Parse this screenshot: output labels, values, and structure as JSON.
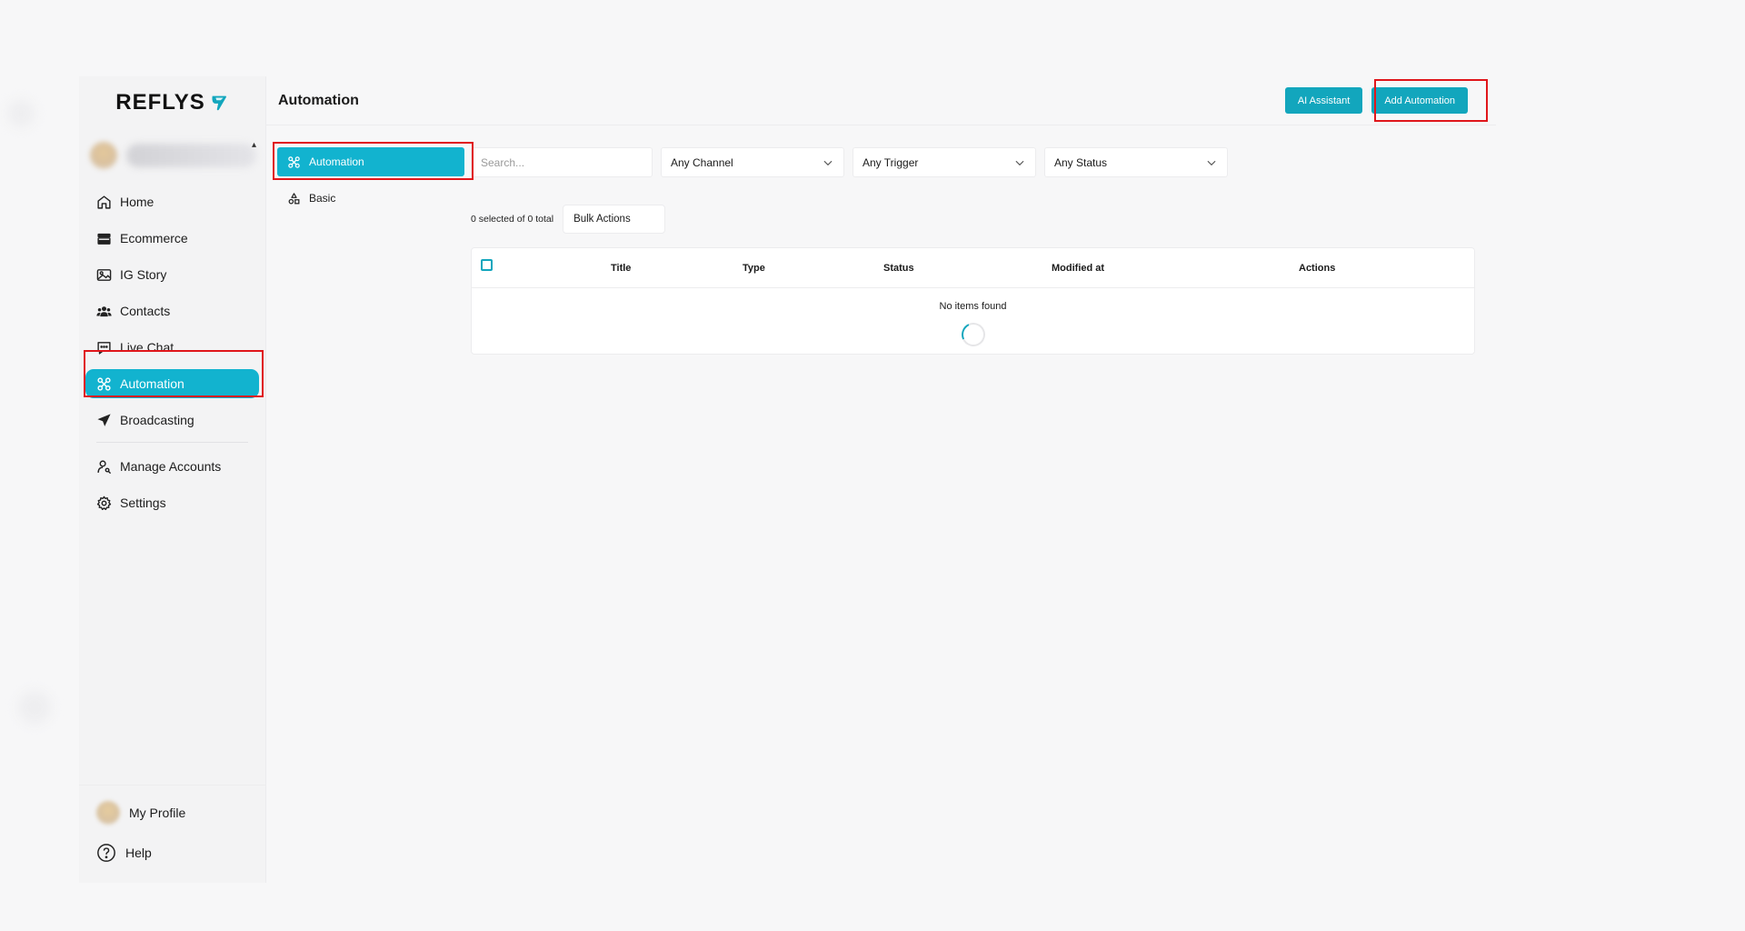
{
  "brand": {
    "name": "REFLYS"
  },
  "sidebar": {
    "items": [
      {
        "key": "home",
        "label": "Home",
        "icon": "home-icon"
      },
      {
        "key": "ecommerce",
        "label": "Ecommerce",
        "icon": "store-icon"
      },
      {
        "key": "ig-story",
        "label": "IG Story",
        "icon": "image-icon"
      },
      {
        "key": "contacts",
        "label": "Contacts",
        "icon": "users-icon"
      },
      {
        "key": "live-chat",
        "label": "Live Chat",
        "icon": "chat-icon"
      },
      {
        "key": "automation",
        "label": "Automation",
        "icon": "automation-icon",
        "active": true
      },
      {
        "key": "broadcasting",
        "label": "Broadcasting",
        "icon": "send-icon"
      }
    ],
    "secondary": [
      {
        "key": "manage-accounts",
        "label": "Manage Accounts",
        "icon": "user-key-icon"
      },
      {
        "key": "settings",
        "label": "Settings",
        "icon": "gear-icon"
      }
    ],
    "bottom": {
      "profile_label": "My Profile",
      "help_label": "Help"
    }
  },
  "header": {
    "title": "Automation",
    "ai_assistant_label": "AI Assistant",
    "add_automation_label": "Add Automation"
  },
  "subnav": {
    "items": [
      {
        "label": "Automation",
        "icon": "automation-icon",
        "active": true
      },
      {
        "label": "Basic",
        "icon": "shapes-icon"
      }
    ]
  },
  "filters": {
    "search_placeholder": "Search...",
    "channel": "Any Channel",
    "trigger": "Any Trigger",
    "status": "Any Status"
  },
  "bulk": {
    "count_text": "0 selected of 0 total",
    "actions_label": "Bulk Actions"
  },
  "table": {
    "columns": [
      "Title",
      "Type",
      "Status",
      "Modified at",
      "Actions"
    ],
    "empty_text": "No items found"
  },
  "colors": {
    "accent": "#12b3cf",
    "button": "#12a6bd",
    "highlight": "#e0161b"
  }
}
